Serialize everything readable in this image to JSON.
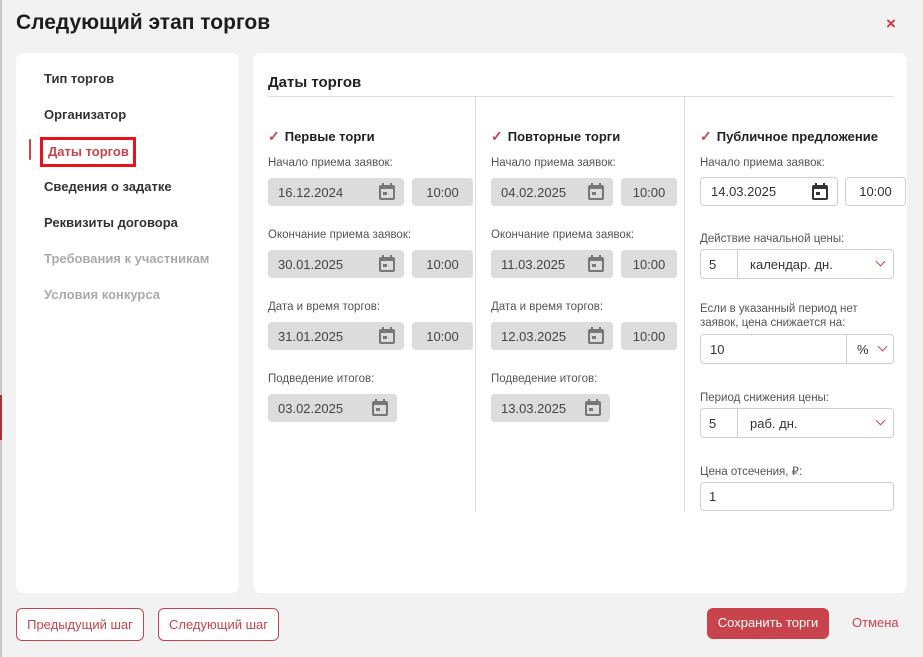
{
  "dialog": {
    "title": "Следующий этап торгов",
    "close_symbol": "×"
  },
  "sidebar": {
    "items": [
      {
        "label": "Тип торгов"
      },
      {
        "label": "Организатор"
      },
      {
        "label": "Даты торгов",
        "active": true
      },
      {
        "label": "Сведения о задатке"
      },
      {
        "label": "Реквизиты договора"
      },
      {
        "label": "Требования к участникам",
        "disabled": true
      },
      {
        "label": "Условия конкурса",
        "disabled": true
      }
    ]
  },
  "main": {
    "title": "Даты торгов",
    "first": {
      "checkbox_label": "Первые торги",
      "start_label": "Начало приема заявок:",
      "start_date": "16.12.2024",
      "start_time": "10:00",
      "end_label": "Окончание приема заявок:",
      "end_date": "30.01.2025",
      "end_time": "10:00",
      "auction_label": "Дата и время торгов:",
      "auction_date": "31.01.2025",
      "auction_time": "10:00",
      "results_label": "Подведение итогов:",
      "results_date": "03.02.2025"
    },
    "repeat": {
      "checkbox_label": "Повторные торги",
      "start_label": "Начало приема заявок:",
      "start_date": "04.02.2025",
      "start_time": "10:00",
      "end_label": "Окончание приема заявок:",
      "end_date": "11.03.2025",
      "end_time": "10:00",
      "auction_label": "Дата и время торгов:",
      "auction_date": "12.03.2025",
      "auction_time": "10:00",
      "results_label": "Подведение итогов:",
      "results_date": "13.03.2025"
    },
    "public": {
      "checkbox_label": "Публичное предложение",
      "start_label": "Начало приема заявок:",
      "start_date": "14.03.2025",
      "start_time": "10:00",
      "initial_price_label": "Действие начальной цены:",
      "initial_price_value": "5",
      "initial_price_unit": "календар. дн.",
      "decrease_label_1": "Если в указанный период нет",
      "decrease_label_2": "заявок, цена снижается на:",
      "decrease_value": "10",
      "decrease_unit": "%",
      "period_label": "Период снижения цены:",
      "period_value": "5",
      "period_unit": "раб. дн.",
      "cutoff_label": "Цена отсечения, ₽:",
      "cutoff_value": "1"
    }
  },
  "footer": {
    "prev": "Предыдущий шаг",
    "next": "Следующий шаг",
    "save": "Сохранить торги",
    "cancel": "Отмена"
  },
  "colors": {
    "accent": "#c8434b",
    "highlight_box": "#e8121c",
    "disabled_field": "#dcdcdc"
  },
  "icons": [
    "close-icon",
    "calendar-icon",
    "checkmark-icon",
    "chevron-down-icon"
  ]
}
